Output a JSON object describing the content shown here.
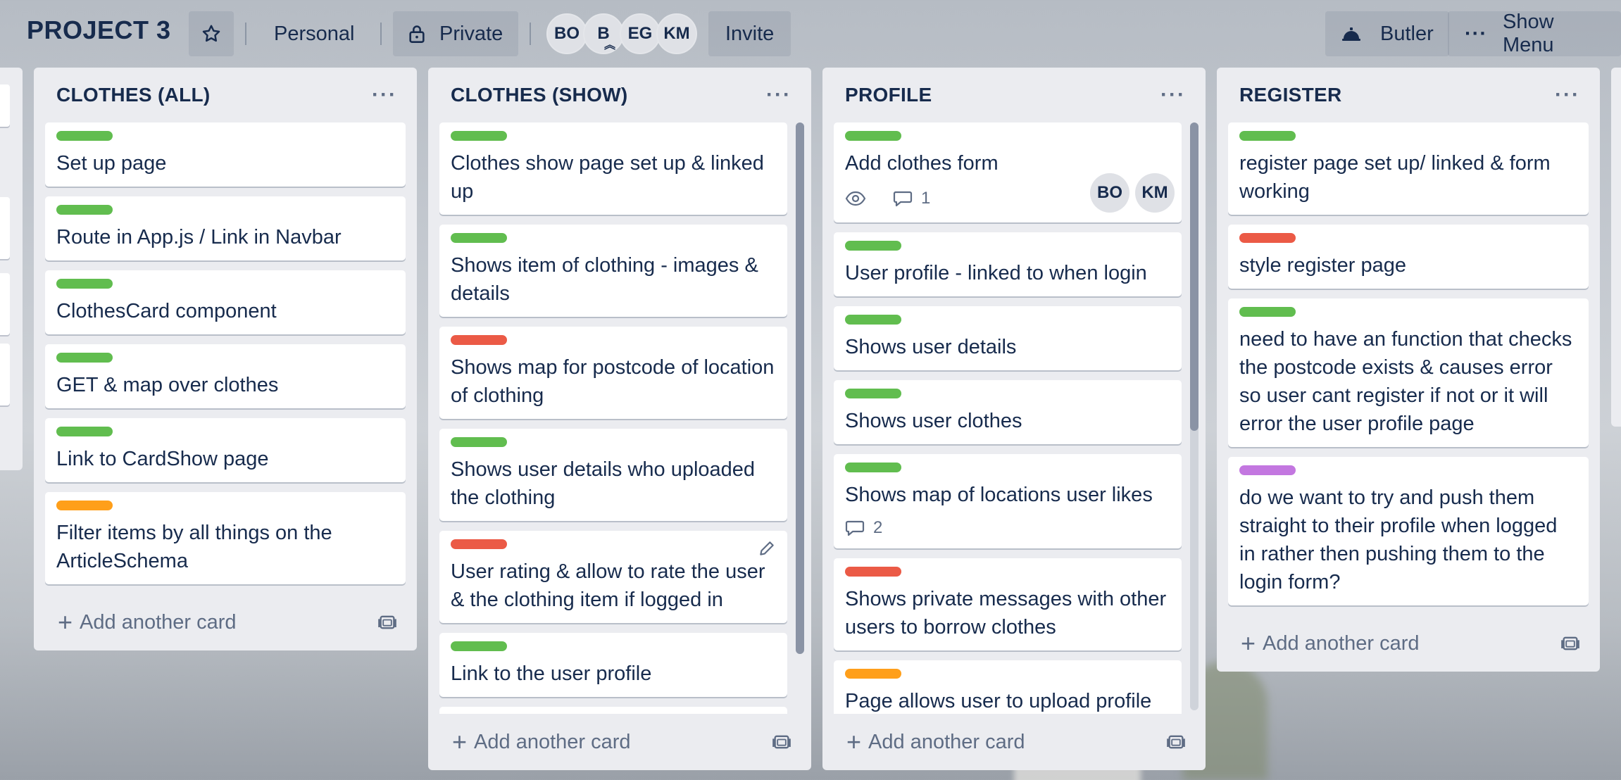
{
  "board": {
    "title": "PROJECT 3",
    "visibility_team": "Personal",
    "visibility_privacy": "Private",
    "members": [
      "BO",
      "B",
      "EG",
      "KM"
    ],
    "invite_label": "Invite",
    "butler_label": "Butler",
    "show_menu_label": "Show Menu"
  },
  "colors": {
    "green": "#61bd4f",
    "red": "#eb5a46",
    "orange": "#ff9f1a",
    "purple": "#c377e0"
  },
  "lists": [
    {
      "title": "CLOTHES (ALL)",
      "add_card_label": "Add another card",
      "cards": [
        {
          "label": "green",
          "title": "Set up page"
        },
        {
          "label": "green",
          "title": "Route in App.js / Link in Navbar"
        },
        {
          "label": "green",
          "title": "ClothesCard component"
        },
        {
          "label": "green",
          "title": "GET & map over clothes"
        },
        {
          "label": "green",
          "title": "Link to CardShow page"
        },
        {
          "label": "orange",
          "title": "Filter items by all things on the ArticleSchema"
        }
      ]
    },
    {
      "title": "CLOTHES (SHOW)",
      "add_card_label": "Add another card",
      "cards": [
        {
          "label": "green",
          "title": "Clothes show page set up & linked up"
        },
        {
          "label": "green",
          "title": "Shows item of clothing - images & details"
        },
        {
          "label": "red",
          "title": "Shows map for postcode of location of clothing"
        },
        {
          "label": "green",
          "title": "Shows user details who uploaded the clothing"
        },
        {
          "label": "red",
          "title": "User rating & allow to rate the user & the clothing item if logged in",
          "editing": true
        },
        {
          "label": "green",
          "title": "Link to the user profile"
        },
        {
          "label": "red",
          "title": ""
        }
      ]
    },
    {
      "title": "PROFILE",
      "add_card_label": "Add another card",
      "cards": [
        {
          "label": "green",
          "title": "Add clothes form",
          "watch": true,
          "comments": "1",
          "members": [
            "BO",
            "KM"
          ]
        },
        {
          "label": "green",
          "title": "User profile - linked to when login"
        },
        {
          "label": "green",
          "title": "Shows user details"
        },
        {
          "label": "green",
          "title": "Shows user clothes"
        },
        {
          "label": "green",
          "title": "Shows map of locations user likes",
          "comments": "2"
        },
        {
          "label": "red",
          "title": "Shows private messages with other users to borrow clothes"
        },
        {
          "label": "orange",
          "title": "Page allows user to upload profile"
        }
      ]
    },
    {
      "title": "REGISTER",
      "add_card_label": "Add another card",
      "cards": [
        {
          "label": "green",
          "title": "register page set up/ linked & form working"
        },
        {
          "label": "red",
          "title": "style register page"
        },
        {
          "label": "green",
          "title": "need to have an function that checks the postcode exists & causes error so user cant register if not or it will error the user profile page"
        },
        {
          "label": "purple",
          "title": "do we want to try and push them straight to their profile when logged in rather then pushing them to the login form?"
        }
      ]
    }
  ]
}
